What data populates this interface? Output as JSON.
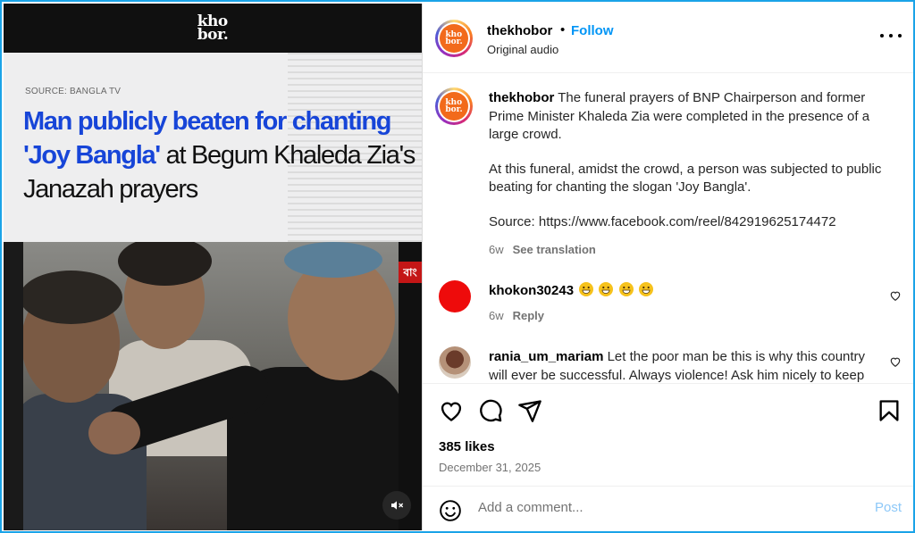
{
  "media": {
    "brand": "kho\nbor.",
    "source_label": "SOURCE: BANGLA TV",
    "headline_blue": "Man publicly beaten for chanting 'Joy Bangla'",
    "headline_rest": " at Begum Khaleda Zia's Janazah prayers",
    "ticker_text": "বাং"
  },
  "header": {
    "username": "thekhobor",
    "separator": "•",
    "follow_label": "Follow",
    "audio": "Original audio",
    "avatar_text": "kho\nbor."
  },
  "caption": {
    "username": "thekhobor",
    "paragraph1": " The funeral prayers of BNP Chairperson and former Prime Minister Khaleda Zia were completed in the presence of a large crowd.",
    "paragraph2": "At this funeral, amidst the crowd, a person was subjected to public beating for chanting the slogan 'Joy Bangla'.",
    "paragraph3": "Source: https://www.facebook.com/reel/842919625174472",
    "age": "6w",
    "translation_label": "See translation"
  },
  "comments": [
    {
      "username": "khokon30243",
      "text": "",
      "emojis": 4,
      "age": "6w",
      "reply_label": "Reply"
    },
    {
      "username": "rania_um_mariam",
      "text": " Let the poor man be this is why this country will ever be successful. Always violence! Ask him nicely to keep"
    }
  ],
  "actions": {
    "likes": "385 likes",
    "date": "December 31, 2025"
  },
  "add_comment": {
    "placeholder": "Add a comment...",
    "post_label": "Post"
  },
  "colors": {
    "accent": "#0095f6",
    "headline_blue": "#1745d8",
    "brand_orange": "#f26a1b",
    "frame_border": "#1aa3e8"
  }
}
